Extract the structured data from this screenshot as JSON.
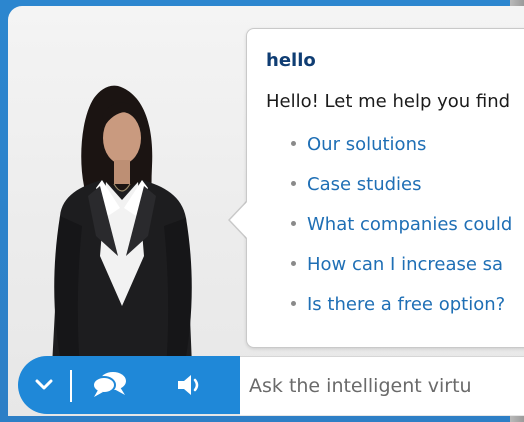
{
  "bubble": {
    "title": "hello",
    "greeting": "Hello! Let me help you find",
    "options": [
      "Our solutions",
      "Case studies",
      "What companies could",
      "How can I increase sa",
      "Is there a free option?"
    ]
  },
  "controls": {
    "collapse_icon": "chevron-down-icon",
    "chat_icon": "speech-bubbles-icon",
    "sound_icon": "speaker-icon"
  },
  "input": {
    "placeholder": "Ask the intelligent virtu"
  },
  "colors": {
    "accent": "#1f88d8",
    "link": "#1f6fb5",
    "title": "#0f3d73"
  }
}
